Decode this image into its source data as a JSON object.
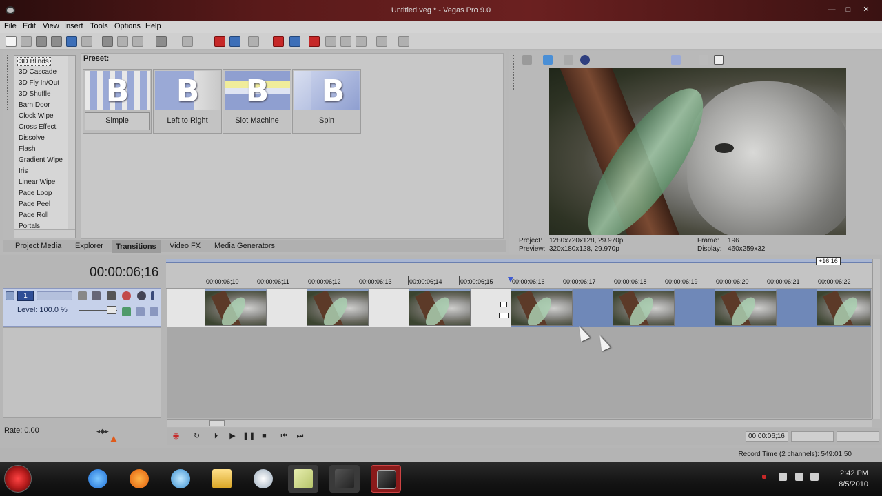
{
  "window": {
    "title": "Untitled.veg * - Vegas Pro 9.0",
    "minimize": "—",
    "maximize": "□",
    "close": "✕"
  },
  "menu": [
    "File",
    "Edit",
    "View",
    "Insert",
    "Tools",
    "Options",
    "Help"
  ],
  "transitions": {
    "preset_label": "Preset:",
    "list": [
      "3D Blinds",
      "3D Cascade",
      "3D Fly In/Out",
      "3D Shuffle",
      "Barn Door",
      "Clock Wipe",
      "Cross Effect",
      "Dissolve",
      "Flash",
      "Gradient Wipe",
      "Iris",
      "Linear Wipe",
      "Page Loop",
      "Page Peel",
      "Page Roll",
      "Portals"
    ],
    "selected": "3D Blinds",
    "presets": [
      {
        "name": "Simple",
        "letter": "B"
      },
      {
        "name": "Left to Right",
        "letter": "B"
      },
      {
        "name": "Slot Machine",
        "letter": "B"
      },
      {
        "name": "Spin",
        "letter": "B"
      }
    ]
  },
  "tabs": [
    "Project Media",
    "Explorer",
    "Transitions",
    "Video FX",
    "Media Generators"
  ],
  "active_tab": "Transitions",
  "preview": {
    "project_label": "Project:",
    "project_value": "1280x720x128, 29.970p",
    "preview_label": "Preview:",
    "preview_value": "320x180x128, 29.970p",
    "frame_label": "Frame:",
    "frame_value": "196",
    "display_label": "Display:",
    "display_value": "460x259x32"
  },
  "timeline": {
    "timecode": "00:00:06;16",
    "end_marker": "+16:16",
    "ticks": [
      "00:00:06;10",
      "00:00:06;11",
      "00:00:06;12",
      "00:00:06;13",
      "00:00:06;14",
      "00:00:06;15",
      "00:00:06;16",
      "00:00:06;17",
      "00:00:06;18",
      "00:00:06;19",
      "00:00:06;20",
      "00:00:06;21",
      "00:00:06;22"
    ],
    "track_number": "1",
    "level": "Level: 100.0 %",
    "rate": "Rate: 0.00",
    "transport_timecode": "00:00:06;16",
    "record_time": "Record Time (2 channels): 549:01:50"
  },
  "taskbar": {
    "time": "2:42 PM",
    "date": "8/5/2010"
  }
}
